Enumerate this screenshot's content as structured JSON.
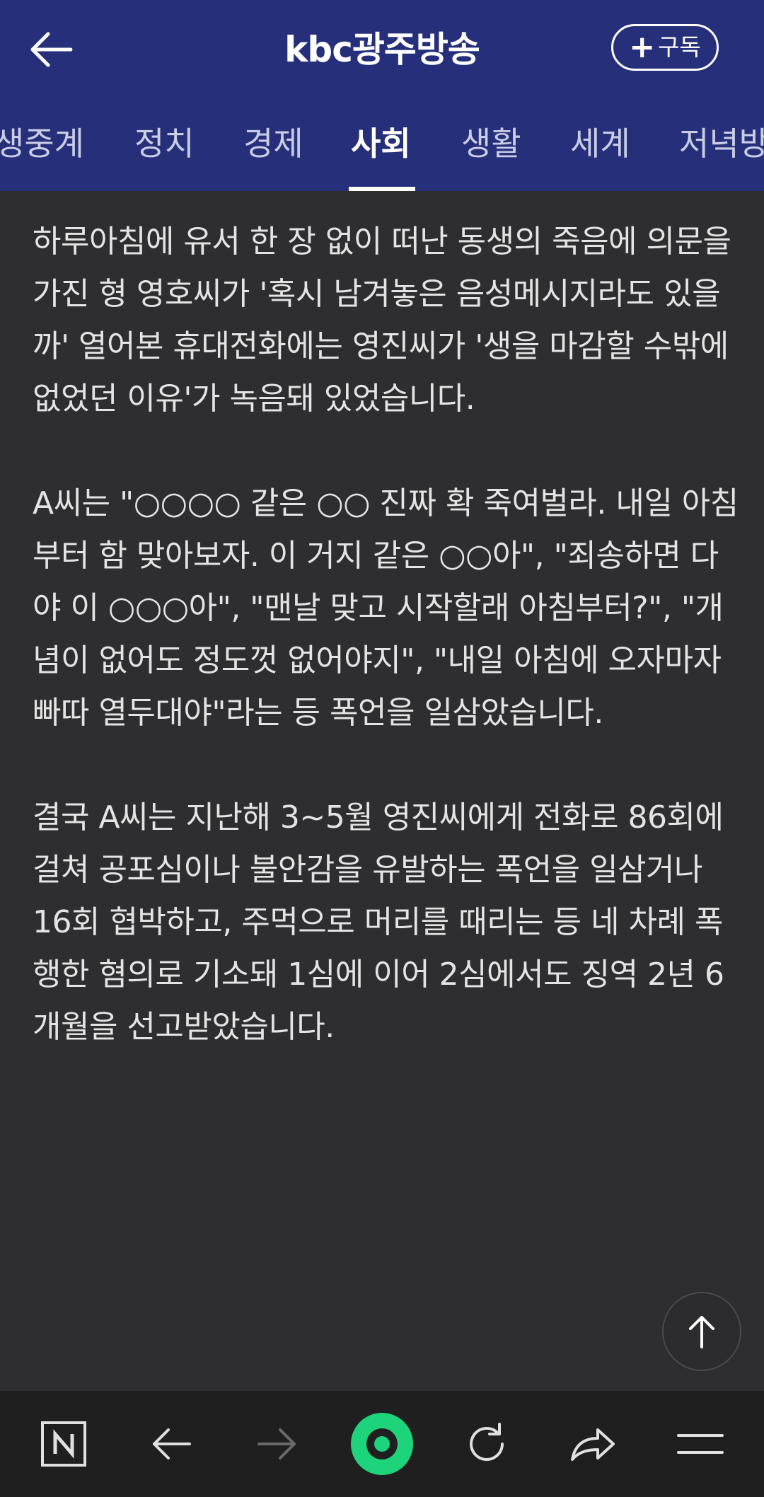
{
  "header": {
    "brand": "kbc광주방송",
    "subscribe_label": "구독"
  },
  "tabs": [
    {
      "label": "생중계"
    },
    {
      "label": "정치"
    },
    {
      "label": "경제"
    },
    {
      "label": "사회",
      "active": true
    },
    {
      "label": "생활"
    },
    {
      "label": "세계"
    },
    {
      "label": "저녁방"
    }
  ],
  "article": {
    "paragraphs": [
      "하루아침에 유서 한 장 없이 떠난 동생의 죽음에 의문을 가진 형 영호씨가 '혹시 남겨놓은 음성메시지라도 있을까' 열어본 휴대전화에는 영진씨가 '생을 마감할 수밖에 없었던 이유'가 녹음돼 있었습니다.",
      "A씨는 \"○○○○ 같은 ○○ 진짜 확 죽여벌라. 내일 아침부터 함 맞아보자. 이 거지 같은 ○○아\", \"죄송하면 다야 이 ○○○아\", \"맨날 맞고 시작할래 아침부터?\", \"개념이 없어도 정도껏 없어야지\", \"내일 아침에 오자마자 빠따 열두대야\"라는 등 폭언을 일삼았습니다.",
      "결국 A씨는 지난해 3~5월 영진씨에게 전화로 86회에 걸쳐 공포심이나 불안감을 유발하는 폭언을 일삼거나 16회 협박하고, 주먹으로 머리를 때리는 등 네 차례 폭행한 혐의로 기소돼 1심에 이어 2심에서도 징역 2년 6개월을 선고받았습니다."
    ]
  },
  "bottom_bar": {
    "icons": [
      "naver-home-icon",
      "back-arrow-icon",
      "forward-arrow-icon",
      "green-dot-icon",
      "refresh-icon",
      "share-icon",
      "menu-icon"
    ]
  },
  "colors": {
    "header_bg": "#26307a",
    "page_bg": "#2e2e30",
    "bottom_bar_bg": "#1f1f20",
    "green_accent": "#1ed47a"
  }
}
